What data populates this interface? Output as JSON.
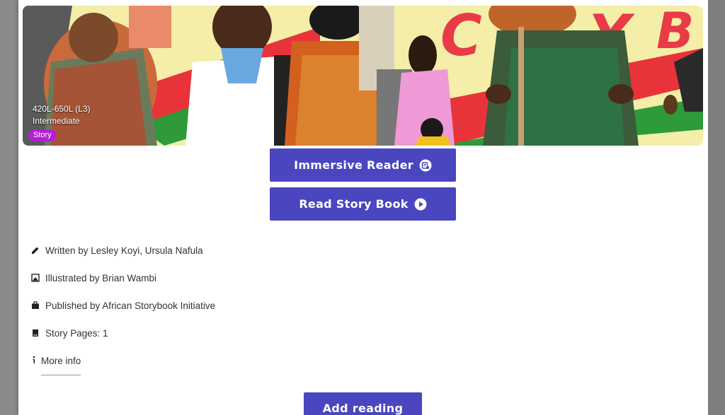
{
  "hero": {
    "level": "420L-650L (L3)",
    "tier": "Intermediate",
    "badge": "Story",
    "badge_color": "#b31fd6"
  },
  "buttons": {
    "immersive_reader": "Immersive Reader",
    "read_story_book": "Read Story Book",
    "add_reading": "Add reading",
    "color": "#4a46bf"
  },
  "meta": {
    "written_by": "Written by Lesley Koyi, Ursula Nafula",
    "illustrated_by": "Illustrated by Brian Wambi",
    "published_by": "Published by African Storybook Initiative",
    "story_pages": "Story Pages: 1",
    "more_info": "More info"
  },
  "icons": {
    "written": "pencil-icon",
    "illustrated": "image-icon",
    "published": "briefcase-icon",
    "pages": "book-icon",
    "more": "info-icon",
    "immersive": "immersive-reader-icon",
    "play": "play-circle-icon"
  }
}
